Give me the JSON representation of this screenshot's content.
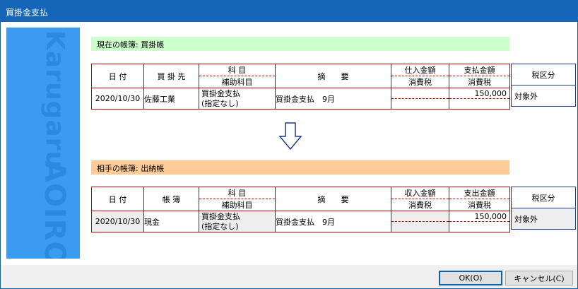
{
  "window": {
    "title": "買掛金支払"
  },
  "brand": {
    "text_top": "Karugaru",
    "text_bottom": "AOIRO"
  },
  "current_book": {
    "label": "現在の帳簿: 買掛帳",
    "headers": {
      "date": "日 付",
      "partner": "買 掛 先",
      "account": "科 目",
      "sub_account": "補助科目",
      "summary": "摘　　要",
      "in_amount": "仕入金額",
      "in_tax": "消費税",
      "out_amount": "支払金額",
      "out_tax": "消費税",
      "tax_category": "税区分"
    },
    "row": {
      "date": "2020/10/30",
      "partner": "佐藤工業",
      "account": "買掛金支払",
      "sub_account": "(指定なし)",
      "summary": "買掛金支払　9月",
      "in_amount": "",
      "in_tax": "",
      "out_amount": "150,000",
      "out_tax": "",
      "tax_category": "対象外"
    }
  },
  "partner_book": {
    "label": "相手の帳簿: 出納帳",
    "headers": {
      "date": "日 付",
      "book": "帳 簿",
      "account": "科 目",
      "sub_account": "補助科目",
      "summary": "摘　　要",
      "in_amount": "収入金額",
      "in_tax": "消費税",
      "out_amount": "支出金額",
      "out_tax": "消費税",
      "tax_category": "税区分"
    },
    "row": {
      "date": "2020/10/30",
      "book": "現金",
      "account": "買掛金支払",
      "sub_account": "(指定なし)",
      "summary": "買掛金支払　9月",
      "in_amount": "",
      "in_tax": "",
      "out_amount": "150,000",
      "out_tax": "",
      "tax_category": "対象外"
    }
  },
  "buttons": {
    "ok": "OK(O)",
    "cancel": "キャンセル(C)"
  },
  "colors": {
    "title_bar": "#1565b8",
    "brand_panel": "#3a9bf0",
    "current_book_bg": "#ccffcc",
    "partner_book_bg": "#ffcc99",
    "grid_line": "#c00000",
    "tax_box_border": "#1f3a88"
  }
}
